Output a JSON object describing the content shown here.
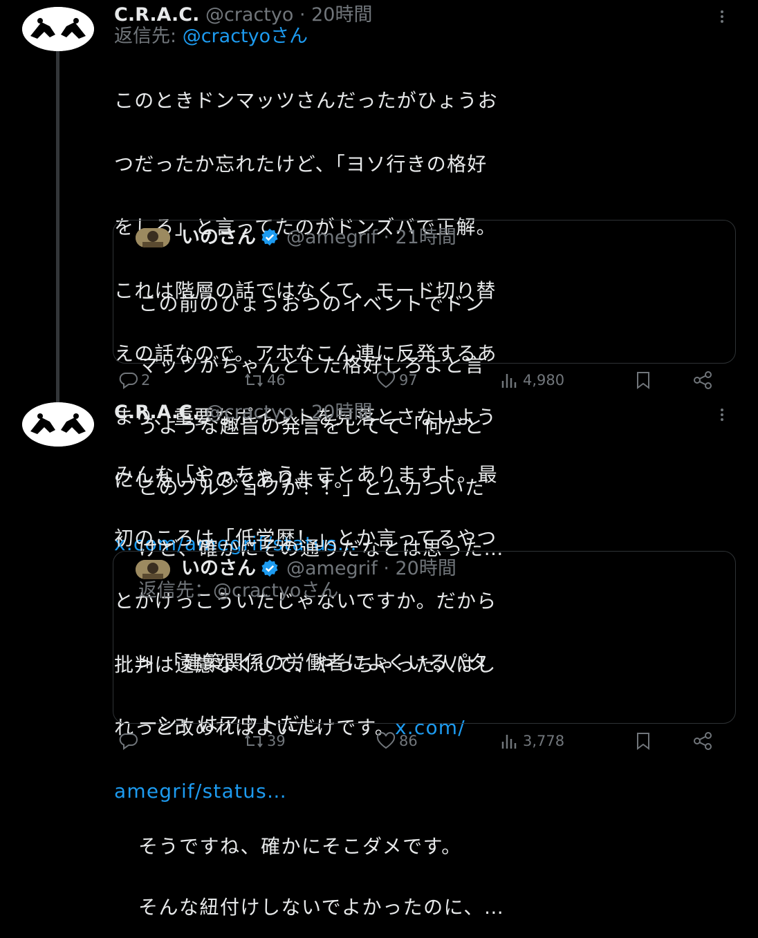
{
  "tweet1": {
    "author_name": "C.R.A.C.",
    "handle": "@cractyo",
    "time": "· 20時間",
    "reply_prefix": "返信先:",
    "reply_handle": "@cractyoさん",
    "text_lines": [
      "このときドンマッツさんだったがひょうお",
      "つだったか忘れたけど、「ヨソ行きの格好",
      "をしろ」と言ってたのがドンズバで正解。",
      "これは階層の話ではなくて、モード切り替",
      "えの話なので。アホなこん連に反発するあ",
      "まり、重要なポイントを見落とさないよう",
      "にしたいものであります。"
    ],
    "link": "x.com/amegrif/status…",
    "quote": {
      "author_name": "いのさん",
      "handle": "@amegrif",
      "time": "· 21時間",
      "text_lines": [
        "この前のひょうおつのイベントでドン",
        "マッツがちゃんとした格好しろよと言",
        "うような趣旨の発言をしてて「何だと",
        "このブルジョワが！！」とムカついた",
        "けど、確かにその通りだなとは思った…"
      ]
    },
    "stats": {
      "replies": "2",
      "reposts": "46",
      "likes": "97",
      "views": "4,980"
    }
  },
  "tweet2": {
    "author_name": "C.R.A.C.",
    "handle": "@cractyo",
    "time": "· 20時間",
    "text_lines": [
      "みんな「やっちゃう」ことありますよ。最",
      "初のころは「低学歴！」とか言ってるやつ",
      "とかけっこういたじゃないですか。だから",
      "批判は遠慮なくして、やっちゃった人はし"
    ],
    "last_line": "れっと改めればよいだけです。",
    "link_part1": "x.com/",
    "link_part2": "amegrif/status…",
    "quote": {
      "author_name": "いのさん",
      "handle": "@amegrif",
      "time": "· 20時間",
      "reply_line": "返信先：@cractyoさん",
      "text_lines": [
        "> 「建築関係の労働者によくいるパタ",
        "ーン」はアウトだし",
        "",
        "そうですね、確かにそこダメです。",
        "そんな紐付けしないでよかったのに、…"
      ]
    },
    "stats": {
      "replies": "",
      "reposts": "39",
      "likes": "86",
      "views": "3,778"
    }
  }
}
